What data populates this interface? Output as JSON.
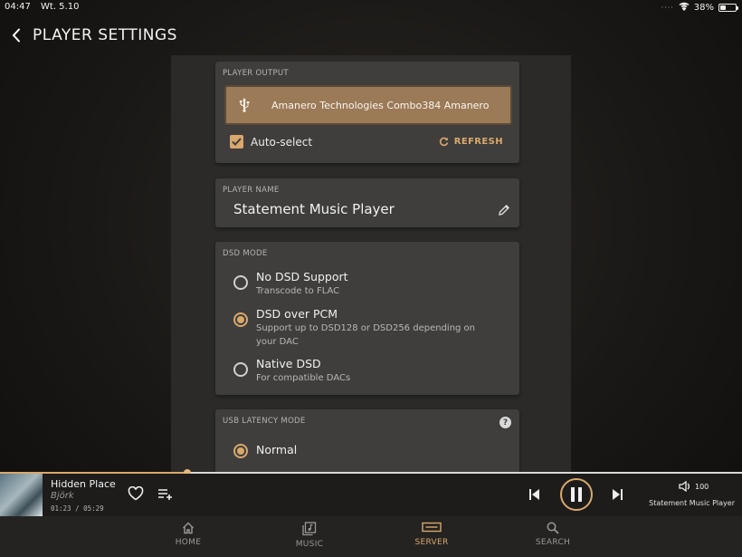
{
  "status_bar": {
    "time": "04:47",
    "date": "Wt. 5.10",
    "battery": "38%",
    "battery_level": 0.38
  },
  "header": {
    "title": "PLAYER SETTINGS"
  },
  "player_output": {
    "section_label": "PLAYER OUTPUT",
    "device": "Amanero Technologies Combo384 Amanero",
    "auto_select_label": "Auto-select",
    "auto_select_checked": true,
    "refresh_label": "REFRESH"
  },
  "player_name": {
    "section_label": "PLAYER NAME",
    "value": "Statement Music Player"
  },
  "dsd_mode": {
    "section_label": "DSD MODE",
    "options": [
      {
        "title": "No DSD Support",
        "subtitle": "Transcode to FLAC",
        "selected": false
      },
      {
        "title": "DSD over PCM",
        "subtitle": "Support up to DSD128 or DSD256 depending on your DAC",
        "selected": true
      },
      {
        "title": "Native DSD",
        "subtitle": "For compatible DACs",
        "selected": false
      }
    ]
  },
  "usb_latency": {
    "section_label": "USB LATENCY MODE",
    "options": [
      {
        "title": "Normal",
        "selected": true
      }
    ]
  },
  "now_playing": {
    "title": "Hidden Place",
    "artist": "Björk",
    "time": "01:23 / 05:29",
    "progress": 0.253,
    "volume": "100",
    "device": "Statement Music Player"
  },
  "nav": {
    "tabs": [
      {
        "label": "HOME",
        "icon": "home-icon",
        "active": false
      },
      {
        "label": "MUSIC",
        "icon": "music-icon",
        "active": false
      },
      {
        "label": "SERVER",
        "icon": "server-icon",
        "active": true
      },
      {
        "label": "SEARCH",
        "icon": "search-icon",
        "active": false
      }
    ]
  },
  "colors": {
    "accent": "#d9a86c",
    "output_button": "#9b7a57",
    "card": "#3f3e3c"
  }
}
